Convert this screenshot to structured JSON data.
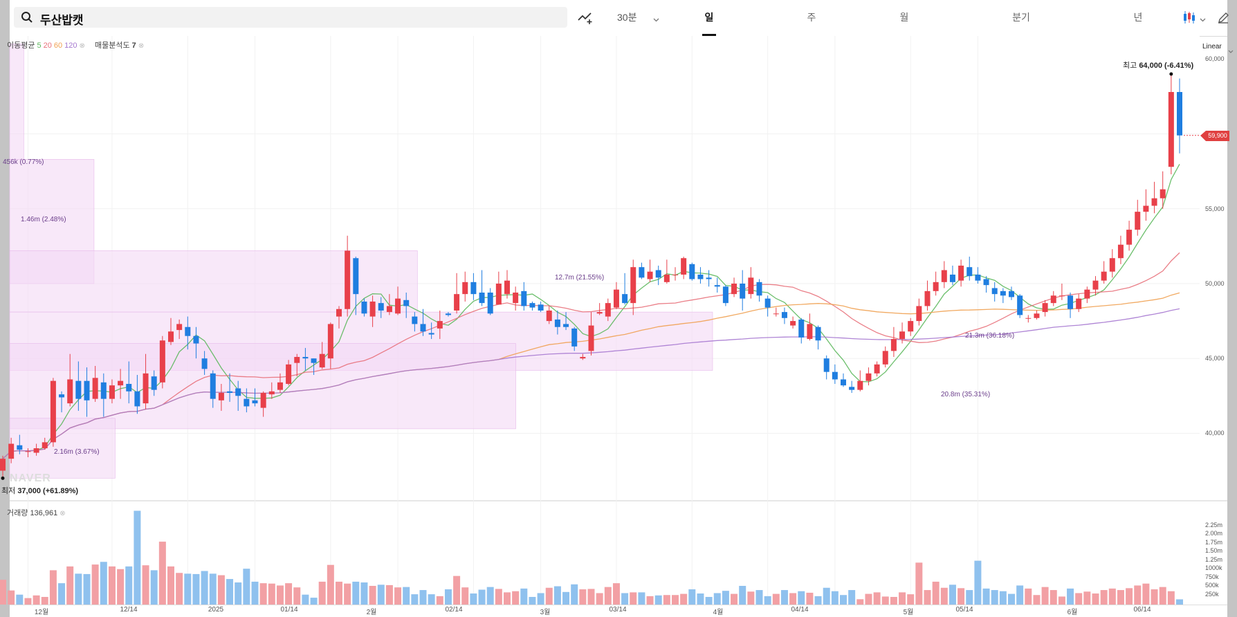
{
  "search": {
    "query": "두산밥캣"
  },
  "toolbar": {
    "interval": "30분",
    "tabs": [
      {
        "label": "일",
        "active": true
      },
      {
        "label": "주",
        "active": false
      },
      {
        "label": "월",
        "active": false
      },
      {
        "label": "분기",
        "active": false
      },
      {
        "label": "년",
        "active": false
      }
    ]
  },
  "legend": {
    "ma_label": "이동평균",
    "ma_periods": [
      {
        "value": "5",
        "color": "#5cb85c"
      },
      {
        "value": "20",
        "color": "#e8707a"
      },
      {
        "value": "60",
        "color": "#f0a050"
      },
      {
        "value": "120",
        "color": "#a678d0"
      }
    ],
    "vp_label": "매물분석도",
    "vp_value": "7",
    "volume_label": "거래량",
    "volume_value": "136,961"
  },
  "scale_mode": "Linear",
  "current_price": "59,900",
  "high_label": {
    "prefix": "최고",
    "value": "64,000",
    "change": "(-6.41%)"
  },
  "low_label": {
    "prefix": "최저",
    "value": "37,000",
    "change": "(+61.89%)"
  },
  "watermark": "NAVER",
  "colors": {
    "up": "#e8404a",
    "down": "#1f7ee0",
    "vol_up": "#f2a0a4",
    "vol_down": "#8fc1ee",
    "profile": "#f3d9f5"
  },
  "volume_profile": [
    {
      "label": "456k (0.77%)",
      "range": [
        58300,
        66000
      ],
      "ratio": 0.02
    },
    {
      "label": "1.46m (2.48%)",
      "range": [
        50000,
        58300
      ],
      "ratio": 0.12
    },
    {
      "label": "12.7m (21.55%)",
      "range": [
        48100,
        52200
      ],
      "ratio": 0.58
    },
    {
      "label": "21.3m (36.18%)",
      "range": [
        44200,
        48100
      ],
      "ratio": 1.0
    },
    {
      "label": "20.8m (35.31%)",
      "range": [
        40300,
        46000
      ],
      "ratio": 0.72
    },
    {
      "label": "2.16m (3.67%)",
      "range": [
        37000,
        41000
      ],
      "ratio": 0.15
    }
  ],
  "chart_data": {
    "type": "candlestick",
    "price_axis": {
      "ticks": [
        "40,000",
        "45,000",
        "50,000",
        "55,000",
        "60,000"
      ],
      "range": [
        36000,
        66500
      ]
    },
    "volume_axis": {
      "ticks": [
        "250k",
        "500k",
        "750k",
        "1000k",
        "1.25m",
        "1.50m",
        "1.75m",
        "2.00m",
        "2.25m"
      ]
    },
    "x_labels": [
      "12월",
      "12/14",
      "2025",
      "01/14",
      "2월",
      "02/14",
      "3월",
      "03/14",
      "4월",
      "04/14",
      "5월",
      "05/14",
      "6월",
      "06/14"
    ],
    "x_label_index": [
      3,
      13,
      22,
      30,
      39,
      47,
      56,
      64,
      73,
      82,
      91,
      99,
      108,
      116
    ],
    "high": 64000,
    "low": 37000,
    "last": 59900,
    "volume_last": 136961,
    "candles": [
      [
        37500,
        38300,
        37100,
        38500,
        650000
      ],
      [
        38300,
        39300,
        38000,
        39700,
        370000
      ],
      [
        39200,
        38900,
        38600,
        39900,
        260000
      ],
      [
        38800,
        38800,
        38400,
        39000,
        170000
      ],
      [
        38700,
        39000,
        38500,
        39300,
        240000
      ],
      [
        39000,
        39400,
        38900,
        39700,
        200000
      ],
      [
        39400,
        43500,
        39100,
        43700,
        900000
      ],
      [
        42600,
        42400,
        41400,
        42800,
        560000
      ],
      [
        42000,
        43600,
        41800,
        45300,
        1000000
      ],
      [
        43500,
        42300,
        41500,
        44800,
        810000
      ],
      [
        43500,
        42200,
        41100,
        44400,
        800000
      ],
      [
        42300,
        43700,
        42100,
        44500,
        1050000
      ],
      [
        43400,
        42300,
        41100,
        44000,
        1120000
      ],
      [
        42300,
        43200,
        42000,
        43600,
        1000000
      ],
      [
        43200,
        43500,
        42300,
        44300,
        930000
      ],
      [
        43300,
        42800,
        42000,
        44800,
        1000000
      ],
      [
        42800,
        41800,
        41300,
        43900,
        2460000
      ],
      [
        42000,
        44000,
        41600,
        45300,
        1030000
      ],
      [
        43800,
        42900,
        42500,
        44200,
        900000
      ],
      [
        43400,
        46200,
        43000,
        46500,
        1650000
      ],
      [
        46100,
        46800,
        45900,
        47700,
        1000000
      ],
      [
        46900,
        47300,
        46300,
        47600,
        830000
      ],
      [
        47100,
        46500,
        45600,
        47800,
        810000
      ],
      [
        46500,
        46000,
        45000,
        47100,
        800000
      ],
      [
        45000,
        44300,
        43900,
        45500,
        880000
      ],
      [
        44000,
        42300,
        41700,
        44200,
        810000
      ],
      [
        42200,
        42700,
        41500,
        43300,
        770000
      ],
      [
        42800,
        42700,
        42100,
        44000,
        670000
      ],
      [
        43000,
        42500,
        41500,
        43500,
        580000
      ],
      [
        42300,
        41800,
        41400,
        43000,
        940000
      ],
      [
        42200,
        42000,
        41800,
        43000,
        600000
      ],
      [
        41700,
        42700,
        41100,
        42800,
        560000
      ],
      [
        42600,
        42800,
        42300,
        43400,
        550000
      ],
      [
        42900,
        43400,
        42700,
        44000,
        500000
      ],
      [
        43300,
        44600,
        43200,
        44900,
        560000
      ],
      [
        44700,
        45100,
        43800,
        45300,
        450000
      ],
      [
        45100,
        45000,
        44200,
        45700,
        260000
      ],
      [
        45000,
        44700,
        43900,
        45000,
        180000
      ],
      [
        44400,
        45300,
        44300,
        46100,
        600000
      ],
      [
        45000,
        47300,
        44300,
        47400,
        1040000
      ],
      [
        47800,
        48300,
        47000,
        48500,
        600000
      ],
      [
        48300,
        52200,
        47800,
        53200,
        550000
      ],
      [
        51700,
        49300,
        47900,
        51800,
        600000
      ],
      [
        48800,
        48000,
        47800,
        49000,
        580000
      ],
      [
        47800,
        48800,
        47100,
        49200,
        490000
      ],
      [
        48700,
        48200,
        47700,
        49100,
        520000
      ],
      [
        48100,
        48500,
        47900,
        49300,
        510000
      ],
      [
        48000,
        49000,
        47900,
        49800,
        450000
      ],
      [
        48900,
        48500,
        47700,
        49400,
        460000
      ],
      [
        47800,
        47300,
        46800,
        48100,
        270000
      ],
      [
        47300,
        46800,
        46500,
        48300,
        380000
      ],
      [
        46700,
        46600,
        46300,
        47400,
        270000
      ],
      [
        47000,
        47500,
        46300,
        48200,
        220000
      ],
      [
        48000,
        47900,
        47800,
        48100,
        400000
      ],
      [
        48200,
        49300,
        48000,
        50700,
        750000
      ],
      [
        49300,
        50100,
        48800,
        50800,
        450000
      ],
      [
        50100,
        49300,
        48900,
        50700,
        290000
      ],
      [
        49400,
        48700,
        48500,
        50900,
        390000
      ],
      [
        49400,
        48000,
        47900,
        49700,
        460000
      ],
      [
        48600,
        50000,
        48600,
        50800,
        410000
      ],
      [
        49300,
        50200,
        49000,
        50900,
        320000
      ],
      [
        48700,
        49400,
        48200,
        49800,
        350000
      ],
      [
        49500,
        48500,
        48200,
        50100,
        420000
      ],
      [
        48700,
        48400,
        48200,
        48800,
        200000
      ],
      [
        48600,
        48200,
        48100,
        48800,
        300000
      ],
      [
        47500,
        48200,
        47300,
        48500,
        440000
      ],
      [
        47600,
        47100,
        46600,
        48200,
        480000
      ],
      [
        47300,
        47100,
        46900,
        48100,
        330000
      ],
      [
        47000,
        45800,
        45500,
        47100,
        530000
      ],
      [
        45000,
        45100,
        44900,
        45300,
        400000
      ],
      [
        45500,
        47200,
        45200,
        48100,
        410000
      ],
      [
        48000,
        48100,
        47900,
        48700,
        300000
      ],
      [
        47800,
        48700,
        47500,
        49000,
        460000
      ],
      [
        48400,
        49600,
        48300,
        50100,
        560000
      ],
      [
        49300,
        48700,
        48600,
        50700,
        300000
      ],
      [
        48700,
        51100,
        47900,
        51600,
        320000
      ],
      [
        51100,
        50400,
        50300,
        51400,
        320000
      ],
      [
        50300,
        50800,
        50100,
        51600,
        220000
      ],
      [
        50900,
        50400,
        49900,
        51200,
        240000
      ],
      [
        50100,
        50600,
        50000,
        51600,
        250000
      ],
      [
        50600,
        50600,
        50200,
        51100,
        250000
      ],
      [
        50600,
        51700,
        50300,
        51800,
        280000
      ],
      [
        51300,
        50300,
        50200,
        51400,
        400000
      ],
      [
        50600,
        50300,
        50000,
        51100,
        290000
      ],
      [
        50400,
        50300,
        49800,
        50900,
        200000
      ],
      [
        49900,
        49800,
        49400,
        50400,
        300000
      ],
      [
        49800,
        48700,
        48500,
        49900,
        360000
      ],
      [
        49300,
        50000,
        49100,
        50400,
        280000
      ],
      [
        50000,
        49000,
        48200,
        50900,
        490000
      ],
      [
        49300,
        50400,
        49000,
        51100,
        340000
      ],
      [
        50100,
        49200,
        48800,
        50300,
        380000
      ],
      [
        49000,
        48400,
        47800,
        49200,
        220000
      ],
      [
        48000,
        48000,
        47800,
        48400,
        280000
      ],
      [
        48100,
        47700,
        47300,
        48400,
        380000
      ],
      [
        47200,
        47500,
        47000,
        47800,
        300000
      ],
      [
        47600,
        46400,
        46000,
        47700,
        350000
      ],
      [
        46300,
        47300,
        46200,
        48000,
        310000
      ],
      [
        47100,
        46200,
        45600,
        47200,
        220000
      ],
      [
        45000,
        44100,
        43600,
        45200,
        440000
      ],
      [
        44100,
        43600,
        43300,
        44600,
        350000
      ],
      [
        43600,
        43200,
        43100,
        44000,
        250000
      ],
      [
        43100,
        42900,
        42700,
        43500,
        380000
      ],
      [
        42900,
        43500,
        42800,
        44200,
        140000
      ],
      [
        43500,
        44000,
        43200,
        44400,
        280000
      ],
      [
        44000,
        44600,
        43800,
        44800,
        320000
      ],
      [
        44600,
        45500,
        44400,
        45800,
        210000
      ],
      [
        45500,
        46300,
        45100,
        47100,
        200000
      ],
      [
        46300,
        46800,
        46000,
        47400,
        320000
      ],
      [
        46800,
        47500,
        46500,
        47700,
        270000
      ],
      [
        47500,
        48500,
        47200,
        49000,
        1100000
      ],
      [
        48500,
        49500,
        48200,
        50200,
        380000
      ],
      [
        49500,
        50100,
        49200,
        50800,
        600000
      ],
      [
        50100,
        50900,
        49700,
        51500,
        440000
      ],
      [
        50600,
        50100,
        49900,
        51200,
        520000
      ],
      [
        50200,
        51200,
        49800,
        51600,
        430000
      ],
      [
        51100,
        50500,
        50200,
        51800,
        380000
      ],
      [
        50600,
        50200,
        50000,
        51100,
        1150000
      ],
      [
        50300,
        49900,
        49400,
        50500,
        420000
      ],
      [
        49700,
        49300,
        48800,
        50100,
        380000
      ],
      [
        49500,
        49200,
        48700,
        49700,
        350000
      ],
      [
        49500,
        49100,
        48900,
        49800,
        280000
      ],
      [
        49200,
        47900,
        47700,
        49300,
        500000
      ],
      [
        47700,
        47700,
        47400,
        47900,
        420000
      ],
      [
        47700,
        48000,
        47600,
        48200,
        250000
      ],
      [
        48100,
        48700,
        47800,
        48900,
        460000
      ],
      [
        48700,
        49200,
        48500,
        49500,
        380000
      ],
      [
        49200,
        49200,
        48900,
        50000,
        210000
      ],
      [
        49200,
        48300,
        47700,
        49400,
        420000
      ],
      [
        48300,
        49000,
        48100,
        49300,
        300000
      ],
      [
        49000,
        49600,
        48700,
        49800,
        340000
      ],
      [
        49600,
        50200,
        49200,
        50500,
        290000
      ],
      [
        50200,
        50800,
        50000,
        51500,
        380000
      ],
      [
        50800,
        51700,
        50400,
        52300,
        420000
      ],
      [
        51700,
        52600,
        51300,
        53200,
        380000
      ],
      [
        52600,
        53600,
        52200,
        54200,
        430000
      ],
      [
        53600,
        54800,
        53200,
        55600,
        500000
      ],
      [
        54800,
        55200,
        54200,
        56300,
        550000
      ],
      [
        55200,
        55700,
        54700,
        56800,
        400000
      ],
      [
        55700,
        56300,
        55000,
        57500,
        460000
      ],
      [
        57800,
        62800,
        57300,
        64000,
        350000
      ],
      [
        62800,
        59900,
        58700,
        63700,
        136961
      ]
    ]
  }
}
